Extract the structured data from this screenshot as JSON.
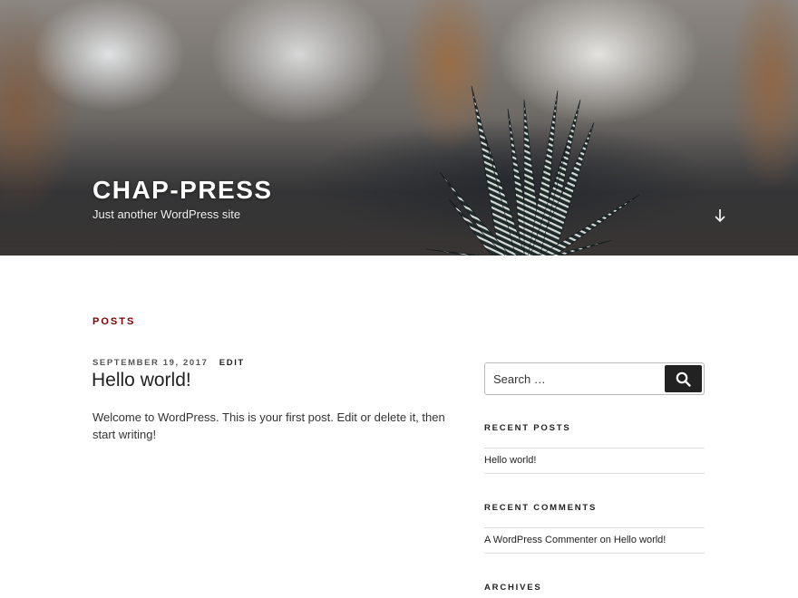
{
  "header": {
    "site_title": "CHAP-PRESS",
    "site_description": "Just another WordPress site",
    "scroll_icon": "arrow-down-icon"
  },
  "main": {
    "page_title": "POSTS",
    "post": {
      "date": "SEPTEMBER 19, 2017",
      "edit_label": "EDIT",
      "title": "Hello world!",
      "excerpt": "Welcome to WordPress. This is your first post. Edit or delete it, then start writing!"
    }
  },
  "sidebar": {
    "search": {
      "placeholder": "Search …",
      "button_icon": "search-icon"
    },
    "recent_posts": {
      "title": "RECENT POSTS",
      "items": [
        "Hello world!"
      ]
    },
    "recent_comments": {
      "title": "RECENT COMMENTS",
      "author": "A WordPress Commenter",
      "on_text": "on",
      "post": "Hello world!"
    },
    "archives": {
      "title": "ARCHIVES"
    }
  },
  "colors": {
    "accent": "#7b0000",
    "text": "#222222",
    "button_bg": "#222222"
  }
}
